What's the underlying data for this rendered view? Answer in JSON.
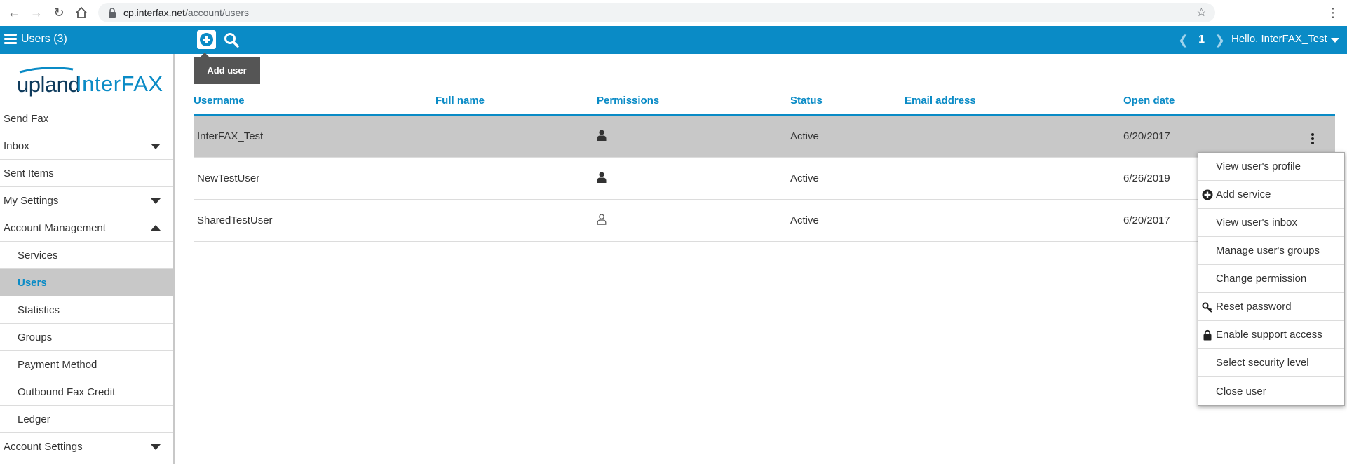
{
  "browser": {
    "host": "cp.interfax.net",
    "path": "/account/users"
  },
  "appbar": {
    "title": "Users (3)",
    "page": "1",
    "greeting": "Hello, InterFAX_Test"
  },
  "tooltip": {
    "label": "Add user"
  },
  "logo": {
    "brand": "upland",
    "product": "InterFAX"
  },
  "sidebar": {
    "items": [
      {
        "label": "Send Fax"
      },
      {
        "label": "Inbox"
      },
      {
        "label": "Sent Items"
      },
      {
        "label": "My Settings"
      },
      {
        "label": "Account Management"
      },
      {
        "label": "Services"
      },
      {
        "label": "Users"
      },
      {
        "label": "Statistics"
      },
      {
        "label": "Groups"
      },
      {
        "label": "Payment Method"
      },
      {
        "label": "Outbound Fax Credit"
      },
      {
        "label": "Ledger"
      },
      {
        "label": "Account Settings"
      }
    ]
  },
  "table": {
    "columns": [
      "Username",
      "Full name",
      "Permissions",
      "Status",
      "Email address",
      "Open date"
    ],
    "rows": [
      {
        "username": "InterFAX_Test",
        "full_name": "",
        "permission_icon": "user-filled-icon",
        "status": "Active",
        "email": "",
        "open_date": "6/20/2017"
      },
      {
        "username": "NewTestUser",
        "full_name": "",
        "permission_icon": "user-filled-icon",
        "status": "Active",
        "email": "",
        "open_date": "6/26/2019"
      },
      {
        "username": "SharedTestUser",
        "full_name": "",
        "permission_icon": "user-outline-icon",
        "status": "Active",
        "email": "",
        "open_date": "6/20/2017"
      }
    ]
  },
  "context_menu": {
    "items": [
      {
        "label": "View user's profile"
      },
      {
        "label": "Add service",
        "icon": "plus-circle-icon"
      },
      {
        "label": "View user's inbox"
      },
      {
        "label": "Manage user's groups"
      },
      {
        "label": "Change permission"
      },
      {
        "label": "Reset password",
        "icon": "key-icon"
      },
      {
        "label": "Enable support access",
        "icon": "lock-icon"
      },
      {
        "label": "Select security level"
      },
      {
        "label": "Close user"
      }
    ]
  },
  "colors": {
    "brand_blue": "#0a8bc6",
    "logo_navy": "#0d3a5c",
    "selected_row": "#c8c8c8"
  }
}
